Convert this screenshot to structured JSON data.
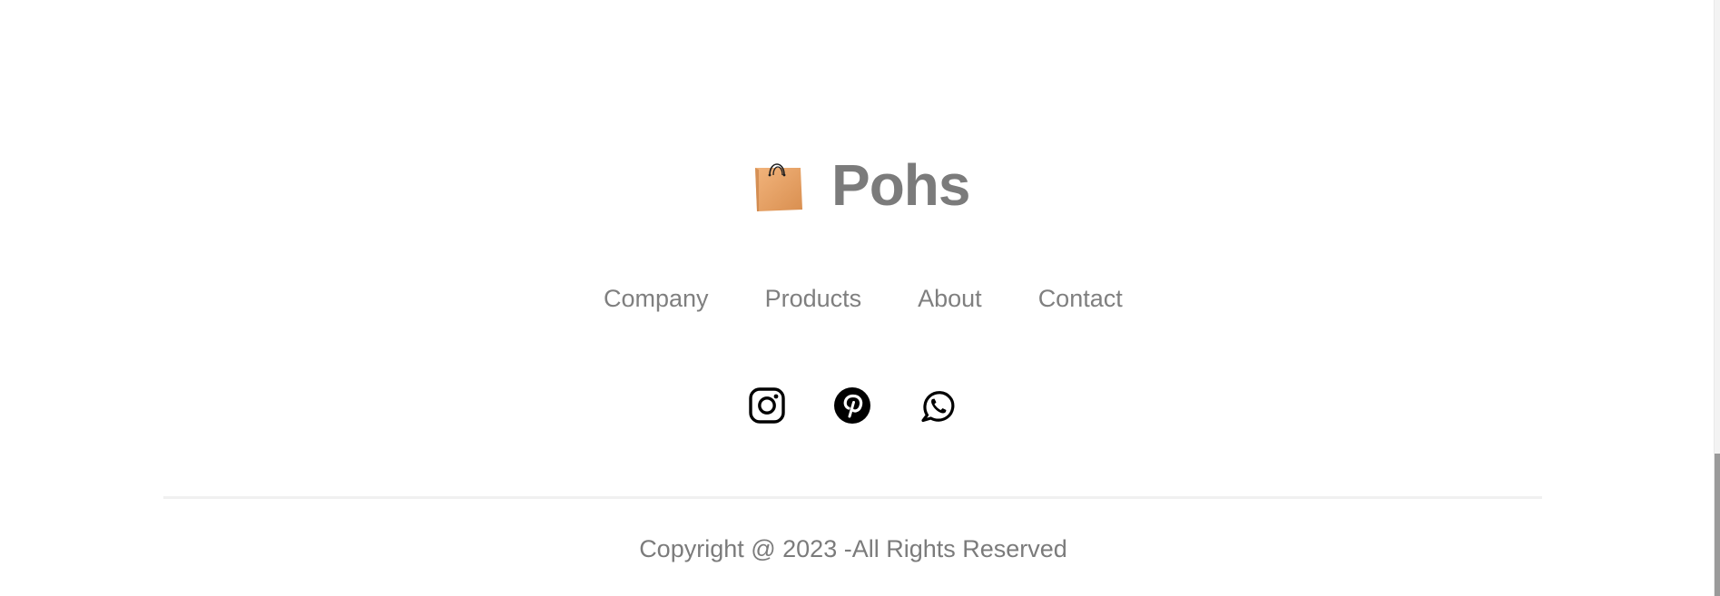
{
  "brand": {
    "name": "Pohs",
    "icon": "shopping-bag-icon",
    "icon_color": "#e8a56a"
  },
  "nav": {
    "items": [
      {
        "label": "Company"
      },
      {
        "label": "Products"
      },
      {
        "label": "About"
      },
      {
        "label": "Contact"
      }
    ]
  },
  "social": {
    "items": [
      {
        "icon": "instagram-icon"
      },
      {
        "icon": "pinterest-icon"
      },
      {
        "icon": "whatsapp-icon"
      }
    ]
  },
  "footer": {
    "copyright": "Copyright @ 2023 -All Rights Reserved"
  },
  "colors": {
    "text": "#7b7b7b",
    "icon": "#000000",
    "divider": "#f0f0f0",
    "background": "#ffffff"
  }
}
